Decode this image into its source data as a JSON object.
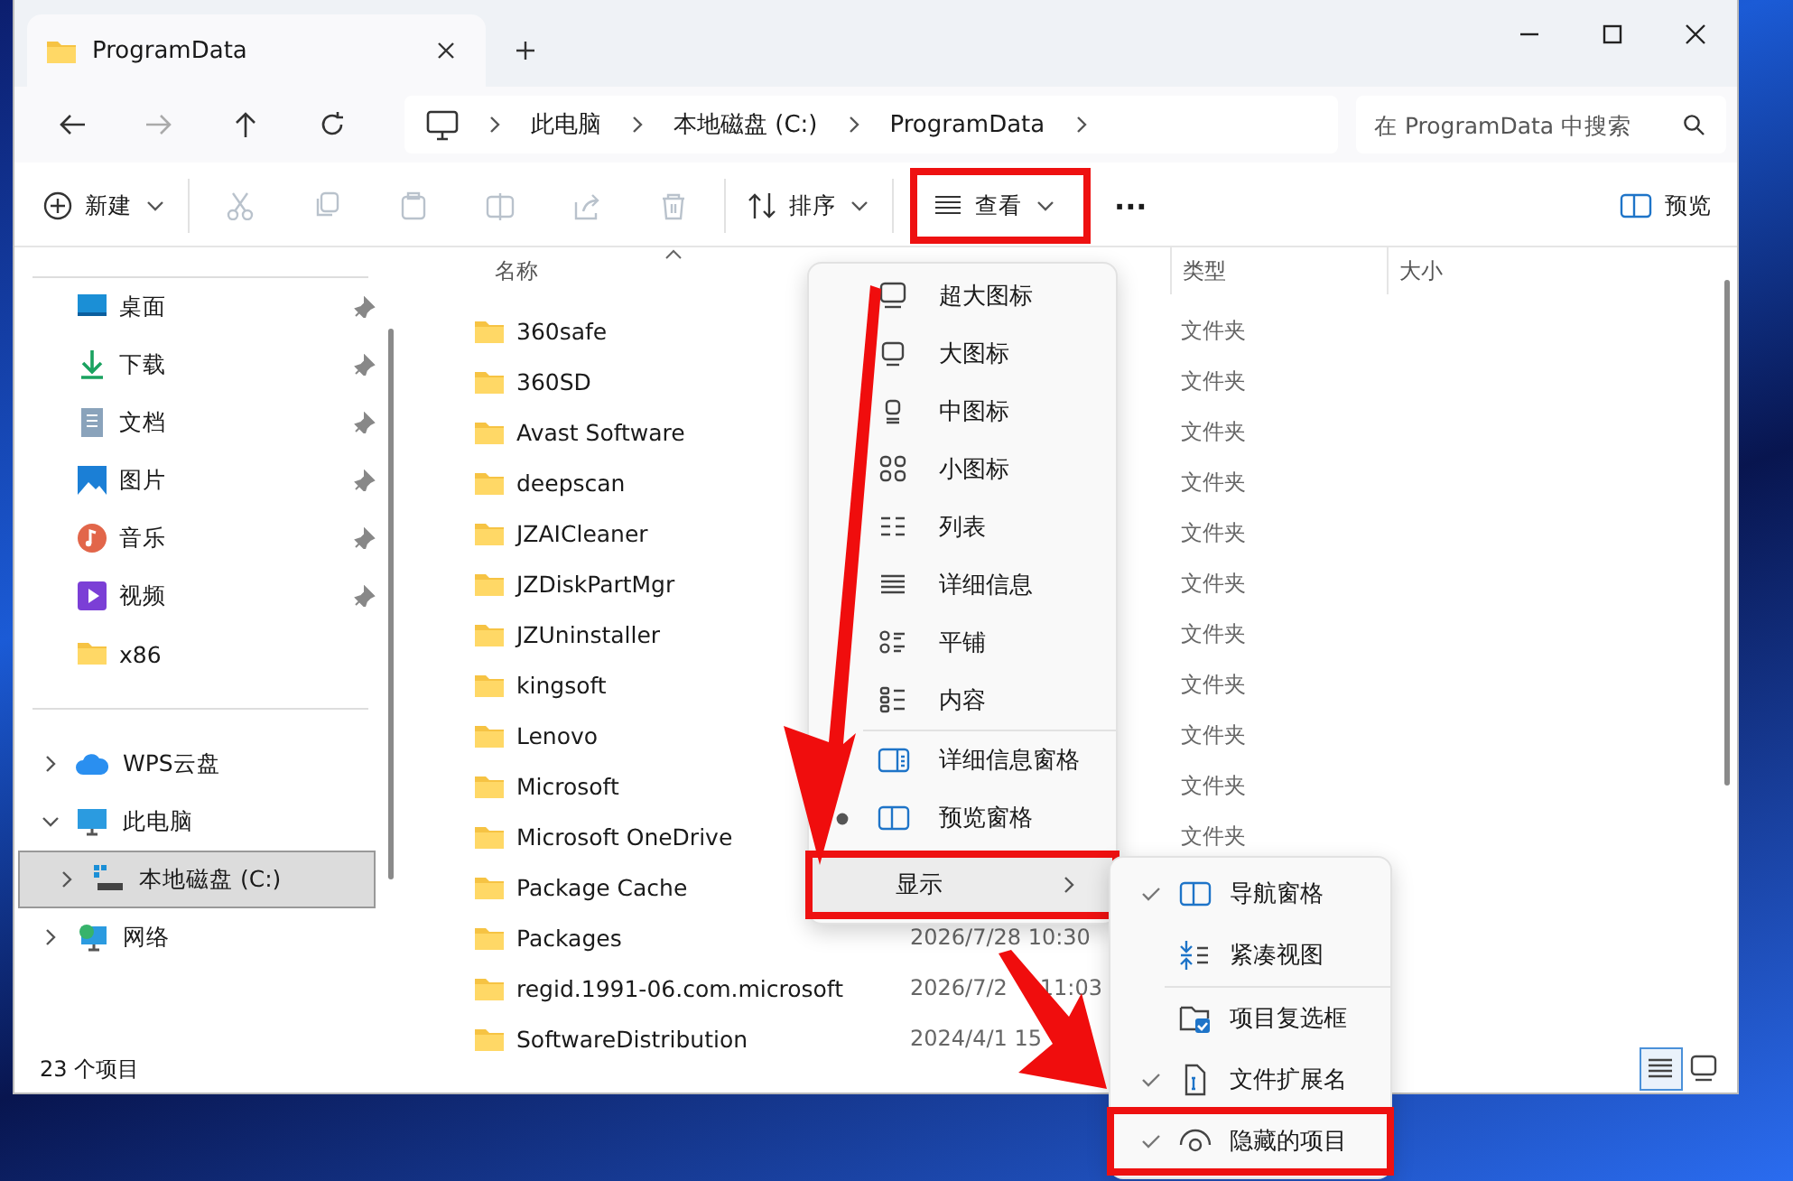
{
  "tab": {
    "title": "ProgramData"
  },
  "address": {
    "crumbs": [
      "此电脑",
      "本地磁盘 (C:)",
      "ProgramData"
    ],
    "search_placeholder": "在 ProgramData 中搜索"
  },
  "toolbar": {
    "new": "新建",
    "sort": "排序",
    "view": {
      "label": "查看",
      "highlighted": true
    },
    "more": "···",
    "preview": "预览"
  },
  "sidebar": {
    "quick_access": [
      {
        "label": "桌面",
        "pinned": true
      },
      {
        "label": "下载",
        "pinned": true
      },
      {
        "label": "文档",
        "pinned": true
      },
      {
        "label": "图片",
        "pinned": true
      },
      {
        "label": "音乐",
        "pinned": true
      },
      {
        "label": "视频",
        "pinned": true
      },
      {
        "label": "x86",
        "pinned": false
      }
    ],
    "tree": [
      {
        "label": "WPS云盘",
        "expanded": false,
        "selected": false
      },
      {
        "label": "此电脑",
        "expanded": true,
        "selected": false,
        "children": [
          {
            "label": "本地磁盘 (C:)",
            "expanded": false,
            "selected": true
          }
        ]
      },
      {
        "label": "网络",
        "expanded": false,
        "selected": false
      }
    ]
  },
  "table": {
    "columns": [
      "名称",
      "类型",
      "大小"
    ],
    "rows": [
      {
        "name": "360safe",
        "type": "文件夹"
      },
      {
        "name": "360SD",
        "type": "文件夹"
      },
      {
        "name": "Avast Software",
        "type": "文件夹"
      },
      {
        "name": "deepscan",
        "type": "文件夹"
      },
      {
        "name": "JZAICleaner",
        "type": "文件夹"
      },
      {
        "name": "JZDiskPartMgr",
        "type": "文件夹"
      },
      {
        "name": "JZUninstaller",
        "type": "文件夹"
      },
      {
        "name": "kingsoft",
        "type": "文件夹"
      },
      {
        "name": "Lenovo",
        "type": "文件夹"
      },
      {
        "name": "Microsoft",
        "type": "文件夹"
      },
      {
        "name": "Microsoft OneDrive",
        "type": "文件夹"
      },
      {
        "name": "Package Cache"
      },
      {
        "name": "Packages",
        "date": "2026/7/28 10:30"
      },
      {
        "name": "regid.1991-06.com.microsoft",
        "date": "2026/7/2",
        "time": "11:03"
      },
      {
        "name": "SoftwareDistribution",
        "date": "2024/4/1 15"
      }
    ]
  },
  "status_bar": {
    "count": "23 个项目",
    "view_buttons": [
      {
        "selected": true
      },
      {
        "selected": false
      }
    ]
  },
  "view_menu": {
    "items": [
      {
        "kind": "item",
        "label": "超大图标",
        "selected": false
      },
      {
        "kind": "item",
        "label": "大图标",
        "selected": false
      },
      {
        "kind": "item",
        "label": "中图标",
        "selected": false
      },
      {
        "kind": "item",
        "label": "小图标",
        "selected": false
      },
      {
        "kind": "item",
        "label": "列表",
        "selected": false
      },
      {
        "kind": "item",
        "label": "详细信息",
        "selected": false
      },
      {
        "kind": "item",
        "label": "平铺",
        "selected": false
      },
      {
        "kind": "item",
        "label": "内容",
        "selected": false
      },
      {
        "kind": "divider"
      },
      {
        "kind": "item",
        "label": "详细信息窗格",
        "selected": false
      },
      {
        "kind": "item",
        "label": "预览窗格",
        "selected": true
      },
      {
        "kind": "submenu",
        "label": "显示",
        "highlighted": true
      }
    ]
  },
  "show_menu": {
    "items": [
      {
        "kind": "item",
        "label": "导航窗格",
        "checked": true,
        "highlighted": false
      },
      {
        "kind": "item",
        "label": "紧凑视图",
        "checked": false,
        "highlighted": false
      },
      {
        "kind": "divider"
      },
      {
        "kind": "item",
        "label": "项目复选框",
        "checked": false,
        "highlighted": false
      },
      {
        "kind": "item",
        "label": "文件扩展名",
        "checked": true,
        "highlighted": false
      },
      {
        "kind": "item",
        "label": "隐藏的项目",
        "checked": true,
        "highlighted": true
      }
    ]
  }
}
